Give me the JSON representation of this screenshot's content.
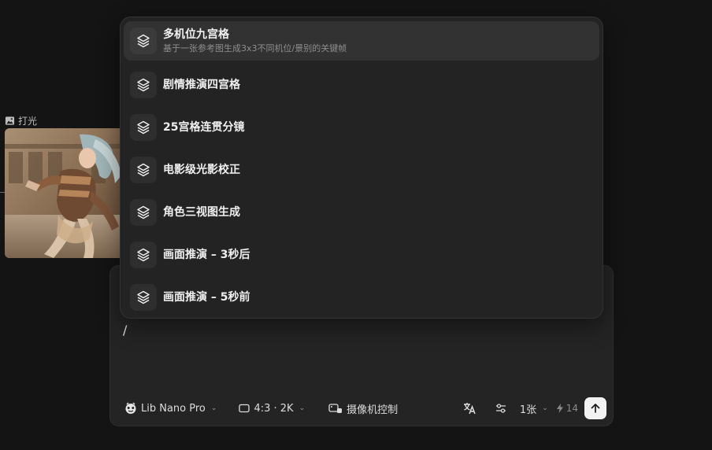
{
  "canvas_node": {
    "label": "打光",
    "icon": "image-icon"
  },
  "menu": {
    "items": [
      {
        "title": "多机位九宫格",
        "description": "基于一张参考图生成3x3不同机位/景别的关键帧",
        "icon": "layers-icon",
        "active": true
      },
      {
        "title": "剧情推演四宫格",
        "description": "",
        "icon": "layers-icon",
        "active": false
      },
      {
        "title": "25宫格连贯分镜",
        "description": "",
        "icon": "layers-icon",
        "active": false
      },
      {
        "title": "电影级光影校正",
        "description": "",
        "icon": "layers-icon",
        "active": false
      },
      {
        "title": "角色三视图生成",
        "description": "",
        "icon": "layers-icon",
        "active": false
      },
      {
        "title": "画面推演 – 3秒后",
        "description": "",
        "icon": "layers-icon",
        "active": false
      },
      {
        "title": "画面推演 – 5秒前",
        "description": "",
        "icon": "layers-icon",
        "active": false
      }
    ]
  },
  "composer": {
    "prompt_value": "/",
    "model": {
      "label": "Lib Nano Pro",
      "icon": "model-logo-icon"
    },
    "aspect": {
      "label": "4:3 · 2K",
      "icon": "aspect-ratio-icon"
    },
    "camera": {
      "label": "摄像机控制",
      "icon": "camera-icon"
    },
    "translate_icon": "translate-icon",
    "settings_icon": "sliders-icon",
    "count": {
      "label": "1张"
    },
    "credits": {
      "value": "14",
      "icon": "lightning-icon"
    },
    "send_icon": "arrow-up-icon"
  }
}
